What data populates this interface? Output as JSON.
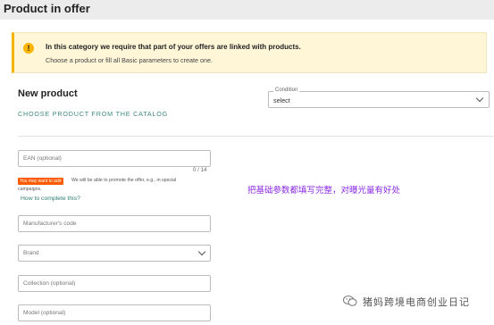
{
  "header": {
    "title": "Product in offer"
  },
  "alert": {
    "title": "In this category we require that part of your offers are linked with products.",
    "body": "Choose a product or fill all Basic parameters to create one.",
    "icon": "warning-icon"
  },
  "new_product": {
    "title": "New product",
    "catalog_link": "CHOOSE PRODUCT FROM THE CATALOG"
  },
  "condition": {
    "legend": "Condition",
    "value": "select"
  },
  "form": {
    "ean": {
      "placeholder": "EAN (optional)",
      "counter": "0 / 14"
    },
    "promo": {
      "badge": "You may want to add",
      "text_line1": "We will be able to promote the offer, e.g., in special",
      "text_line2": "campaigns."
    },
    "how_link": "How to complete this?",
    "manufacturer_code": {
      "placeholder": "Manufacturer's code"
    },
    "brand": {
      "placeholder": "Brand"
    },
    "collection": {
      "placeholder": "Collection (optional)"
    },
    "model": {
      "placeholder": "Model (optional)"
    }
  },
  "annotation": "把基础参数都填写完整，对曝光量有好处",
  "watermark": "猪妈跨境电商创业日记",
  "colors": {
    "accent": "#3e8a7c",
    "warning": "#f4b400",
    "badge": "#ff5a00",
    "annotation": "#8a2be2"
  }
}
